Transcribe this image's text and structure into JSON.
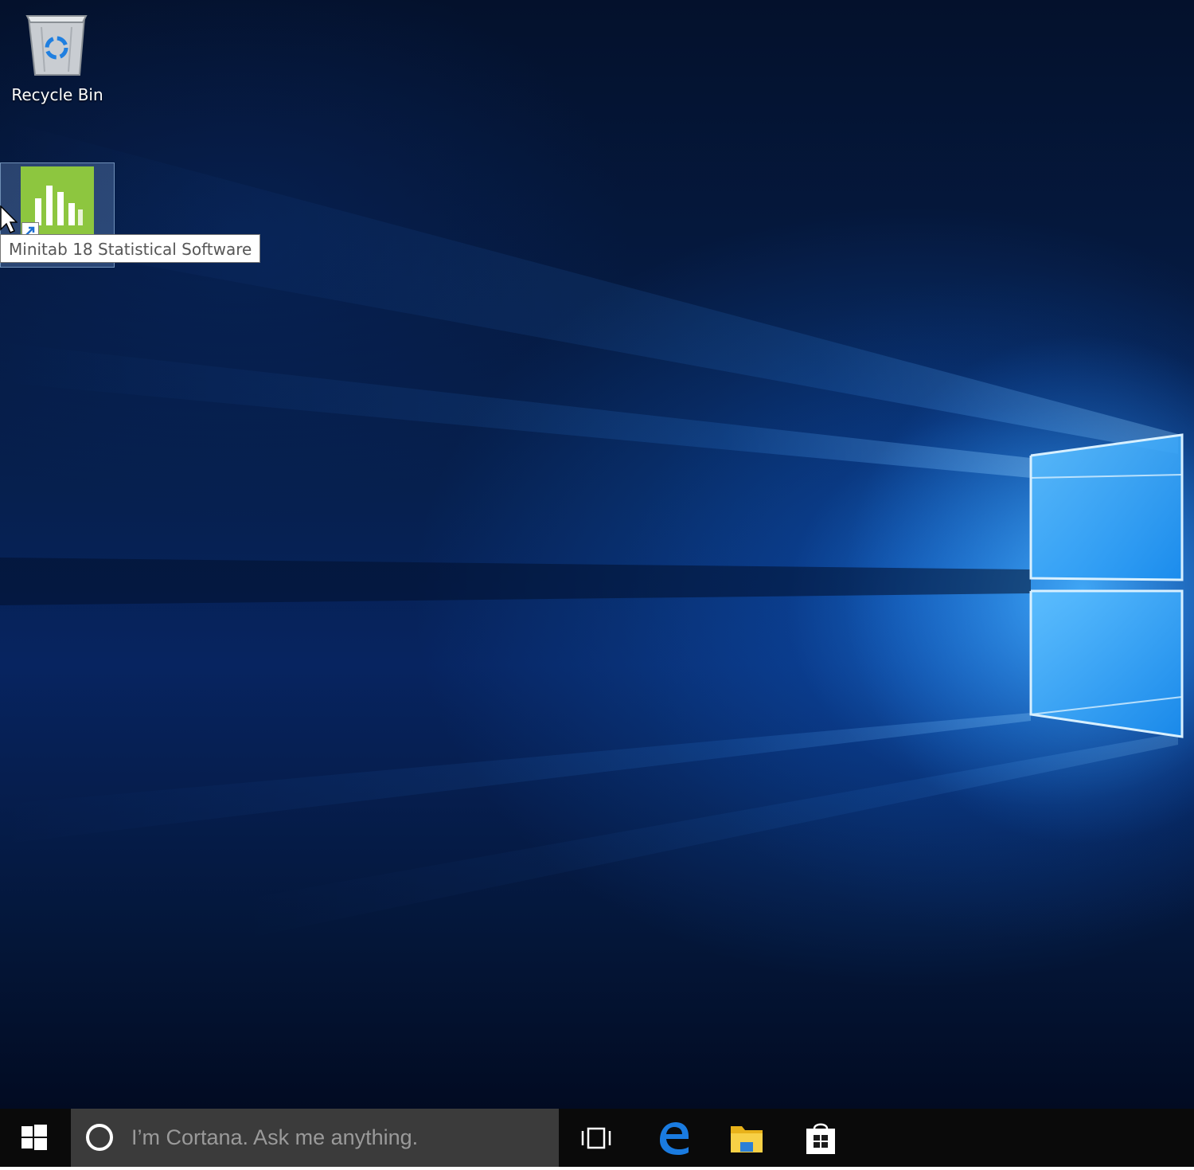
{
  "desktop": {
    "icons": [
      {
        "label": "Recycle Bin",
        "icon": "recycle-bin-icon"
      },
      {
        "label": "Minitab 18 Statistical Software",
        "icon": "minitab-icon",
        "selected": true
      }
    ],
    "tooltip": "Minitab 18 Statistical Software",
    "accent_color": "#8dc63f"
  },
  "taskbar": {
    "start_icon": "windows-logo-icon",
    "search_placeholder": "I’m Cortana. Ask me anything.",
    "pinned": [
      {
        "name": "task-view",
        "icon": "task-view-icon"
      },
      {
        "name": "microsoft-edge",
        "icon": "edge-icon",
        "color": "#0078d7"
      },
      {
        "name": "file-explorer",
        "icon": "folder-icon",
        "color": "#f0c419"
      },
      {
        "name": "store",
        "icon": "store-icon"
      }
    ]
  }
}
